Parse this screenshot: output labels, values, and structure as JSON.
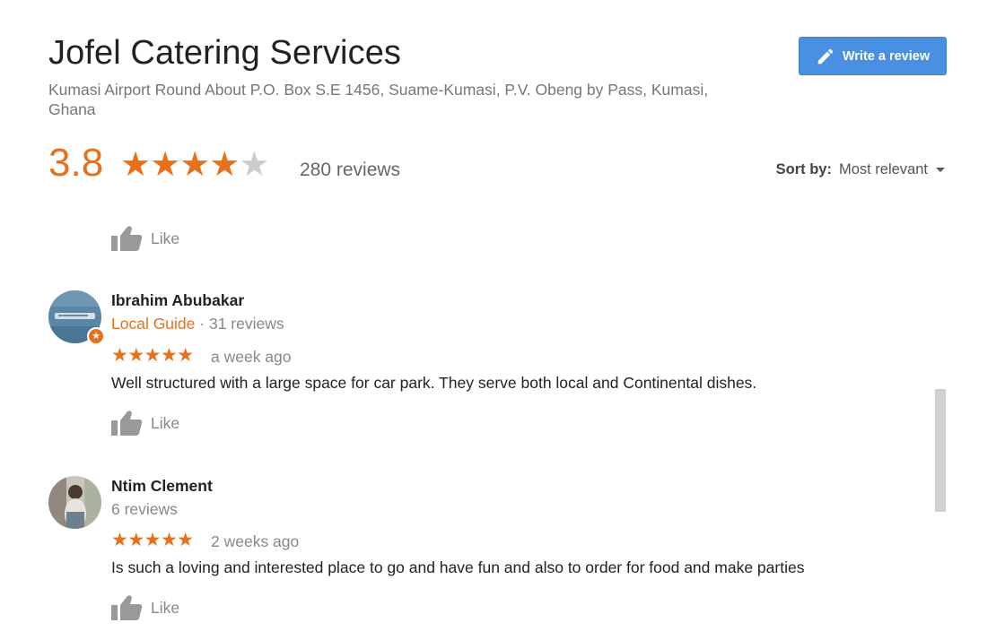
{
  "place": {
    "title": "Jofel Catering Services",
    "address": "Kumasi Airport Round About P.O. Box S.E 1456, Suame-Kumasi, P.V. Obeng by Pass, Kumasi, Ghana",
    "rating": "3.8",
    "rating_value": 3.8,
    "review_count": "280 reviews",
    "write_review_label": "Write a review"
  },
  "sort": {
    "label": "Sort by:",
    "value": "Most relevant"
  },
  "colors": {
    "accent": "#e7711b",
    "button": "#4a90e2",
    "muted": "#888888"
  },
  "like_label": "Like",
  "reviews": [
    {
      "name": "Ibrahim Abubakar",
      "badge": "Local Guide",
      "count": "31 reviews",
      "separator": "·",
      "stars": "★★★★★",
      "rating": 5,
      "date": "a week ago",
      "text": "Well structured with a large space for car park. They serve both local and Continental dishes."
    },
    {
      "name": "Ntim Clement",
      "count": "6 reviews",
      "stars": "★★★★★",
      "rating": 5,
      "date": "2 weeks ago",
      "text": "Is such a loving and interested place to go and have fun and also to order for food and make parties"
    }
  ]
}
